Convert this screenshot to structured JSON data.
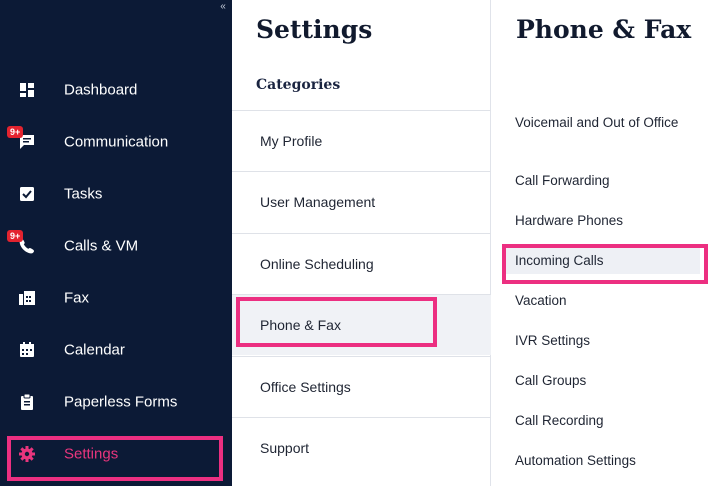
{
  "sidebar": {
    "collapse_glyph": "«",
    "items": [
      {
        "label": "Dashboard",
        "icon": "dashboard-icon"
      },
      {
        "label": "Communication",
        "icon": "chat-icon",
        "badge": "9+"
      },
      {
        "label": "Tasks",
        "icon": "checkbox-icon"
      },
      {
        "label": "Calls & VM",
        "icon": "phone-icon",
        "badge": "9+"
      },
      {
        "label": "Fax",
        "icon": "fax-icon"
      },
      {
        "label": "Calendar",
        "icon": "calendar-icon"
      },
      {
        "label": "Paperless Forms",
        "icon": "clipboard-icon"
      },
      {
        "label": "Settings",
        "icon": "gear-icon",
        "active": true
      }
    ]
  },
  "settings": {
    "title": "Settings",
    "categories_label": "Categories",
    "items": [
      "My Profile",
      "User Management",
      "Online Scheduling",
      "Phone & Fax",
      "Office Settings",
      "Support"
    ],
    "selected": "Phone & Fax"
  },
  "phone_fax": {
    "title": "Phone & Fax",
    "items": [
      "Voicemail and Out of Office",
      "Call Forwarding",
      "Hardware Phones",
      "Incoming Calls",
      "Vacation",
      "IVR Settings",
      "Call Groups",
      "Call Recording",
      "Automation Settings"
    ],
    "selected": "Incoming Calls"
  },
  "colors": {
    "sidebar_bg": "#0c1a36",
    "accent_pink": "#e9357d",
    "highlight": "#ec2f81",
    "badge": "#e3232f"
  }
}
